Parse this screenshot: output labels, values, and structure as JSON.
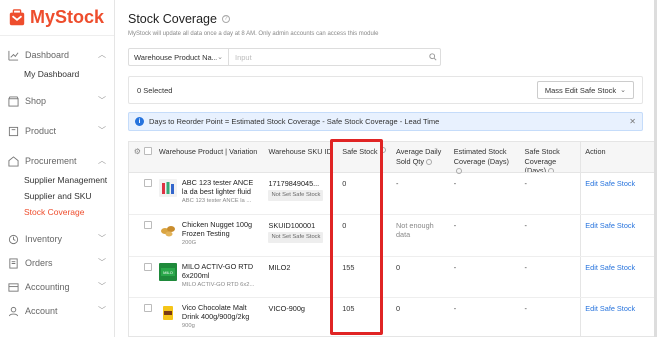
{
  "app": {
    "logo_text": "MyStock",
    "brand_color": "#ee4d2d",
    "accent_color": "#2673dd"
  },
  "sidebar": {
    "groups": [
      {
        "label": "Dashboard",
        "icon": "chart-icon",
        "chevron": "up",
        "items": [
          {
            "label": "My Dashboard",
            "active": false
          }
        ]
      },
      {
        "label": "Shop",
        "icon": "shop-icon",
        "chevron": "down",
        "items": []
      },
      {
        "label": "Product",
        "icon": "product-icon",
        "chevron": "down",
        "items": []
      },
      {
        "label": "Procurement",
        "icon": "procurement-icon",
        "chevron": "up",
        "items": [
          {
            "label": "Supplier Management",
            "active": false
          },
          {
            "label": "Supplier and SKU",
            "active": false
          },
          {
            "label": "Stock Coverage",
            "active": true
          }
        ]
      },
      {
        "label": "Inventory",
        "icon": "inventory-icon",
        "chevron": "down",
        "items": []
      },
      {
        "label": "Orders",
        "icon": "orders-icon",
        "chevron": "down",
        "items": []
      },
      {
        "label": "Accounting",
        "icon": "accounting-icon",
        "chevron": "down",
        "items": []
      },
      {
        "label": "Account",
        "icon": "account-icon",
        "chevron": "down",
        "items": []
      }
    ]
  },
  "main": {
    "title": "Stock Coverage",
    "subtitle": "MyStock will update all data once a day at 8 AM. Only admin accounts can access this module",
    "filter": {
      "select_label": "Warehouse Product Na...",
      "input_placeholder": "Input"
    },
    "toolbar": {
      "selected_label": "0 Selected",
      "mass_edit_label": "Mass Edit Safe Stock"
    },
    "banner": {
      "text": "Days to Reorder Point = Estimated Stock Coverage - Safe Stock Coverage - Lead Time"
    },
    "table": {
      "headers": {
        "product": "Warehouse Product | Variation",
        "sku": "Warehouse SKU ID",
        "safe": "Safe Stock",
        "avg": "Average Daily Sold Qty",
        "est": "Estimated Stock Coverage (Days)",
        "ssc": "Safe Stock Coverage (Days)",
        "action": "Action"
      },
      "rows": [
        {
          "name": "ABC 123 tester ANCE la da best lighter fluid",
          "variation": "ABC 123 tester ANCE la ...",
          "sku": "17179849045...",
          "sku_badge": "Not Set Safe Stock",
          "safe": "0",
          "avg": "-",
          "est": "-",
          "ssc": "-",
          "action": "Edit Safe Stock",
          "thumb": "bottles"
        },
        {
          "name": "Chicken Nugget 100g Frozen Testing",
          "variation": "200G",
          "sku": "SKUID100001",
          "sku_badge": "Not Set Safe Stock",
          "safe": "0",
          "avg": "Not enough data",
          "est": "-",
          "ssc": "-",
          "action": "Edit Safe Stock",
          "thumb": "nuggets"
        },
        {
          "name": "MILO ACTIV-GO RTD 6x200ml",
          "variation": "MILO ACTIV-GO RTD 6x2...",
          "sku": "MILO2",
          "sku_badge": "",
          "safe": "155",
          "avg": "0",
          "est": "-",
          "ssc": "-",
          "action": "Edit Safe Stock",
          "thumb": "milo"
        },
        {
          "name": "Vico Chocolate Malt Drink 400g/900g/2kg",
          "variation": "900g",
          "sku": "VICO-900g",
          "sku_badge": "",
          "safe": "105",
          "avg": "0",
          "est": "-",
          "ssc": "-",
          "action": "Edit Safe Stock",
          "thumb": "vico"
        }
      ]
    }
  }
}
